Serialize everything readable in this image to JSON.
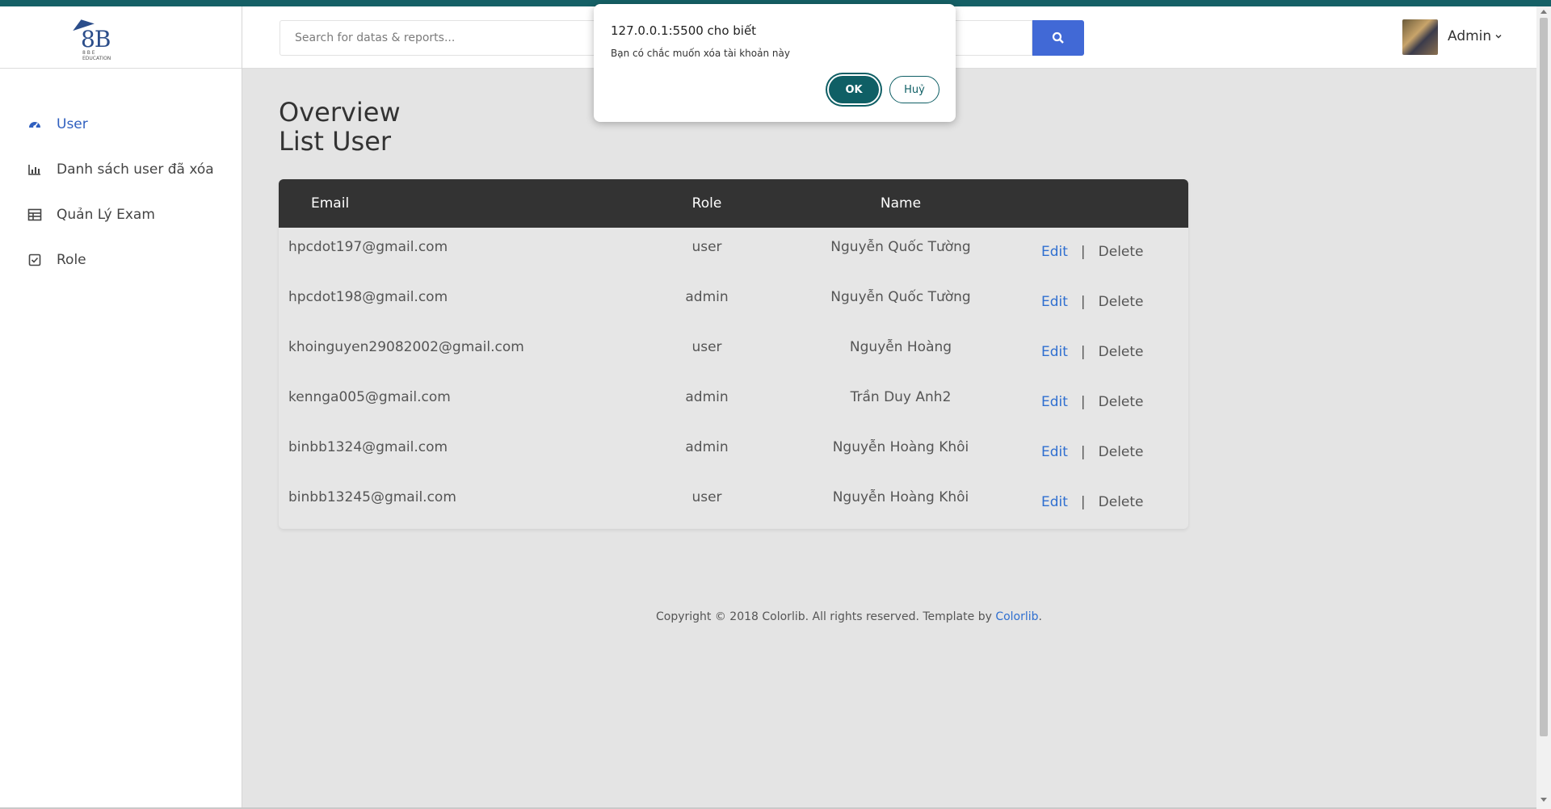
{
  "brand": {
    "logo_text": "8B",
    "logo_sub": "8 B E EDUCATION"
  },
  "sidebar": {
    "items": [
      {
        "label": "User",
        "icon": "dashboard-icon",
        "active": true
      },
      {
        "label": "Danh sách user đã xóa",
        "icon": "bar-chart-icon"
      },
      {
        "label": "Quản Lý Exam",
        "icon": "table-icon"
      },
      {
        "label": "Role",
        "icon": "checkbox-icon"
      }
    ]
  },
  "header": {
    "search_placeholder": "Search for datas & reports...",
    "user_name": "Admin",
    "accent_color": "#4169d6"
  },
  "main": {
    "title": "Overview",
    "subtitle": "List User",
    "table": {
      "columns": [
        "Email",
        "Role",
        "Name"
      ],
      "rows": [
        {
          "email": "hpcdot197@gmail.com",
          "role": "user",
          "name": "Nguyễn Quốc Tường"
        },
        {
          "email": "hpcdot198@gmail.com",
          "role": "admin",
          "name": "Nguyễn Quốc Tường"
        },
        {
          "email": "khoinguyen29082002@gmail.com",
          "role": "user",
          "name": "Nguyễn Hoàng"
        },
        {
          "email": "kennga005@gmail.com",
          "role": "admin",
          "name": "Trần Duy Anh2"
        },
        {
          "email": "binbb1324@gmail.com",
          "role": "admin",
          "name": "Nguyễn Hoàng Khôi"
        },
        {
          "email": "binbb13245@gmail.com",
          "role": "user",
          "name": "Nguyễn Hoàng Khôi"
        }
      ],
      "edit_label": "Edit",
      "separator": "|",
      "delete_label": "Delete"
    }
  },
  "footer": {
    "text": "Copyright © 2018 Colorlib. All rights reserved. Template by ",
    "link": "Colorlib",
    "trail": "."
  },
  "dialog": {
    "title": "127.0.0.1:5500 cho biết",
    "message": "Bạn có chắc muốn xóa tài khoản này",
    "ok_label": "OK",
    "cancel_label": "Huỷ",
    "button_color": "#0f5f65"
  }
}
